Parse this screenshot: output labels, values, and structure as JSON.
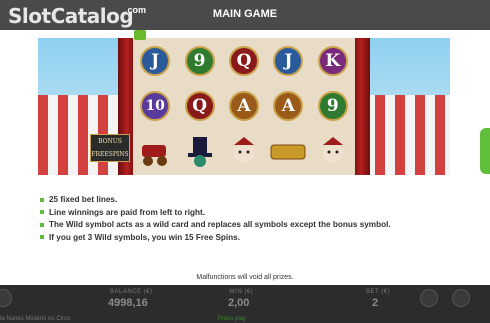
{
  "header": {
    "logo_part1": "Slot",
    "logo_part2": "Catalog",
    "logo_dotcom": ".com",
    "title": "MAIN GAME"
  },
  "reels": [
    [
      "J",
      "9",
      "Q",
      "J",
      "K"
    ],
    [
      "10",
      "Q",
      "A",
      "A",
      "9"
    ],
    [
      "",
      "",
      "",
      "",
      ""
    ]
  ],
  "bonus_badge": [
    "BONUS",
    "FREESPINS"
  ],
  "rules": [
    "25 fixed bet lines.",
    "Line winnings are paid from left to right.",
    "The Wild symbol acts as a wild card and replaces all symbols except the bonus symbol.",
    "If you get 3 Wild symbols, you win 15 Free Spins."
  ],
  "footer_note": "Malfunctions will void all prizes.",
  "bottom": {
    "balance_label": "BALANCE (€)",
    "balance_value": "4998,16",
    "win_label": "WIN (€)",
    "win_value": "2,00",
    "bet_label": "BET (€)",
    "bet_value": "2",
    "game_name": "la Nunes Mistério no Circo",
    "press_play": "Press play"
  },
  "colors": {
    "accent": "#5fbf3a",
    "header_bg": "#4a4a4a"
  }
}
